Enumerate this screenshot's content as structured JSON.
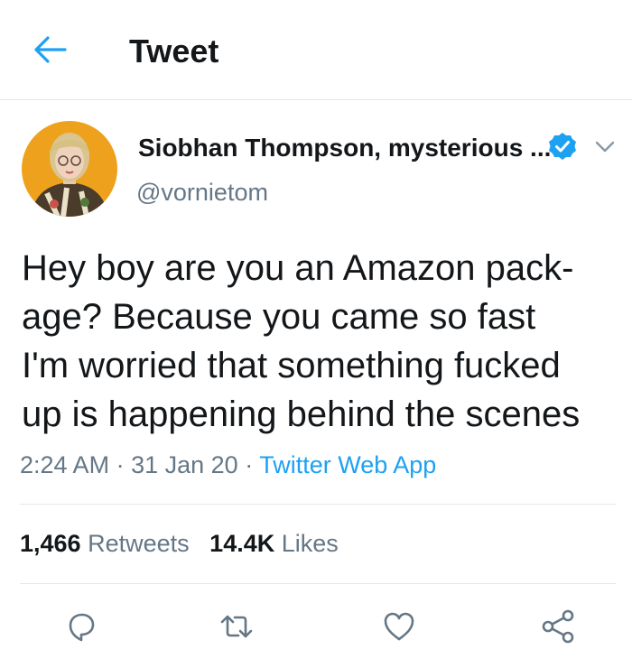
{
  "header": {
    "title": "Tweet",
    "back_icon": "back-arrow-icon"
  },
  "colors": {
    "accent": "#1da1f2",
    "text": "#14171a",
    "muted": "#657786",
    "divider": "#e1e8ed"
  },
  "author": {
    "display_name": "Siobhan Thompson, mysterious ...",
    "handle": "@vornietom",
    "verified": true
  },
  "tweet": {
    "lines": [
      "Hey boy are you an Amazon pack-",
      "age? Because you came so fast",
      "I'm worried that something fucked",
      "up is happening behind the scenes"
    ],
    "time": "2:24 AM",
    "date": "31 Jan 20",
    "source": "Twitter Web App",
    "separator": "·"
  },
  "stats": {
    "retweets_count": "1,466",
    "retweets_label": "Retweets",
    "likes_count": "14.4K",
    "likes_label": "Likes"
  },
  "actions": [
    "reply-icon",
    "retweet-icon",
    "like-icon",
    "share-icon"
  ]
}
